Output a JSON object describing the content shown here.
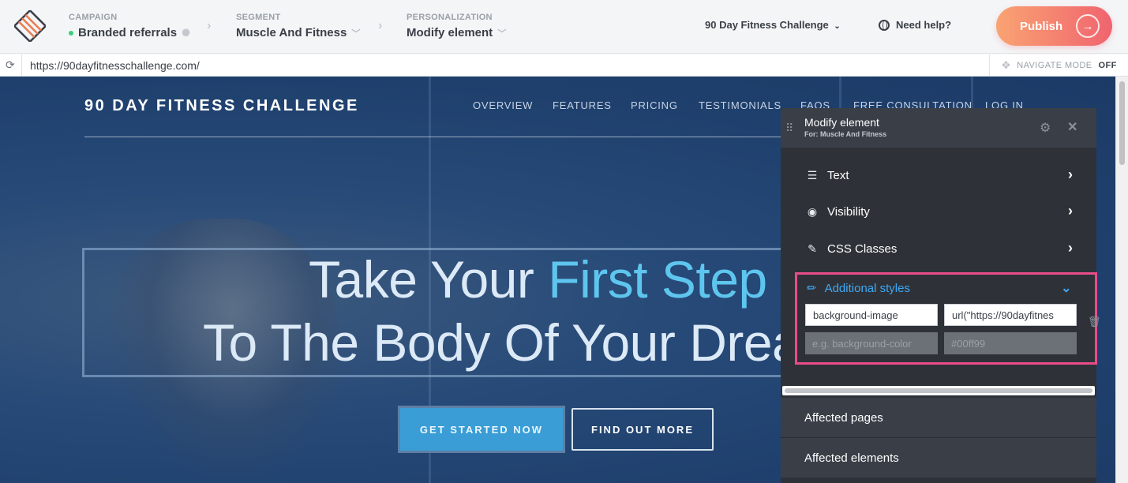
{
  "topbar": {
    "campaign_label": "CAMPAIGN",
    "campaign_value": "Branded referrals",
    "segment_label": "SEGMENT",
    "segment_value": "Muscle And Fitness",
    "personalization_label": "PERSONALIZATION",
    "personalization_value": "Modify element",
    "campaign_select": "90 Day Fitness Challenge",
    "help": "Need help?",
    "publish": "Publish",
    "status_color": "#3ccf7a"
  },
  "urlbar": {
    "url": "https://90dayfitnesschallenge.com/",
    "navigate_mode_label": "NAVIGATE MODE",
    "navigate_mode_value": "OFF"
  },
  "site": {
    "logo": "90 DAY FITNESS CHALLENGE",
    "nav": [
      "OVERVIEW",
      "FEATURES",
      "PRICING",
      "TESTIMONIALS",
      "FAQS",
      "FREE CONSULTATION",
      "LOG IN"
    ],
    "hero_line1_a": "Take Your ",
    "hero_line1_b": "First Step",
    "hero_line2": "To The Body Of Your Dreams",
    "cta_primary": "GET STARTED NOW",
    "cta_secondary": "FIND OUT MORE"
  },
  "panel": {
    "title": "Modify element",
    "subtitle": "For: Muscle And Fitness",
    "menu": [
      "Text",
      "Visibility",
      "CSS Classes"
    ],
    "styles_title": "Additional styles",
    "property_value": "background-image",
    "css_value": "url(\"https://90dayfitnes",
    "property_placeholder": "e.g. background-color",
    "value_placeholder": "#00ff99",
    "affected_pages": "Affected pages",
    "affected_elements": "Affected elements",
    "highlight_color": "#ea4c89",
    "accent_color": "#3fa9f5"
  },
  "icons": [
    "logo-icon",
    "settings-icon",
    "chevron-right-icon",
    "chevron-down-icon",
    "globe-icon",
    "arrow-right-icon",
    "refresh-icon",
    "crosshair-icon",
    "drag-handle-icon",
    "gear-icon",
    "close-icon",
    "text-lines-icon",
    "eye-icon",
    "brush-icon",
    "pencil-icon",
    "trash-icon"
  ]
}
